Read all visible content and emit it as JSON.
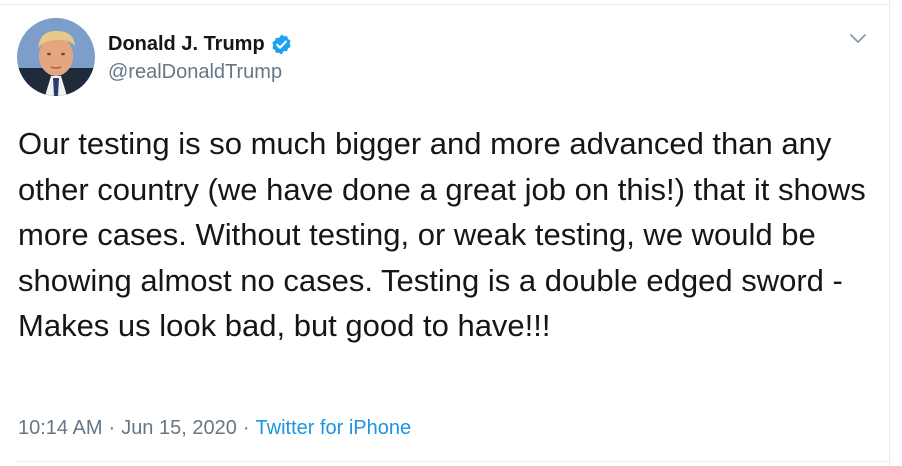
{
  "author": {
    "display_name": "Donald J. Trump",
    "handle": "@realDonaldTrump",
    "verified": true,
    "avatar": "profile-photo"
  },
  "tweet": {
    "text": "Our testing is so much bigger and more advanced than any other country (we have done a great job on this!) that it shows more cases. Without testing, or weak testing, we would be showing almost no cases. Testing is a double edged sword - Makes us look bad, but good to have!!!",
    "time": "10:14 AM",
    "separator": "·",
    "date": "Jun 15, 2020",
    "source": "Twitter for iPhone"
  },
  "icons": {
    "verified": "verified-badge-icon",
    "menu": "chevron-down-icon"
  },
  "colors": {
    "text": "#14171a",
    "muted": "#657786",
    "link": "#1b95e0",
    "verified": "#1da1f2",
    "divider": "#e6ecf0"
  }
}
